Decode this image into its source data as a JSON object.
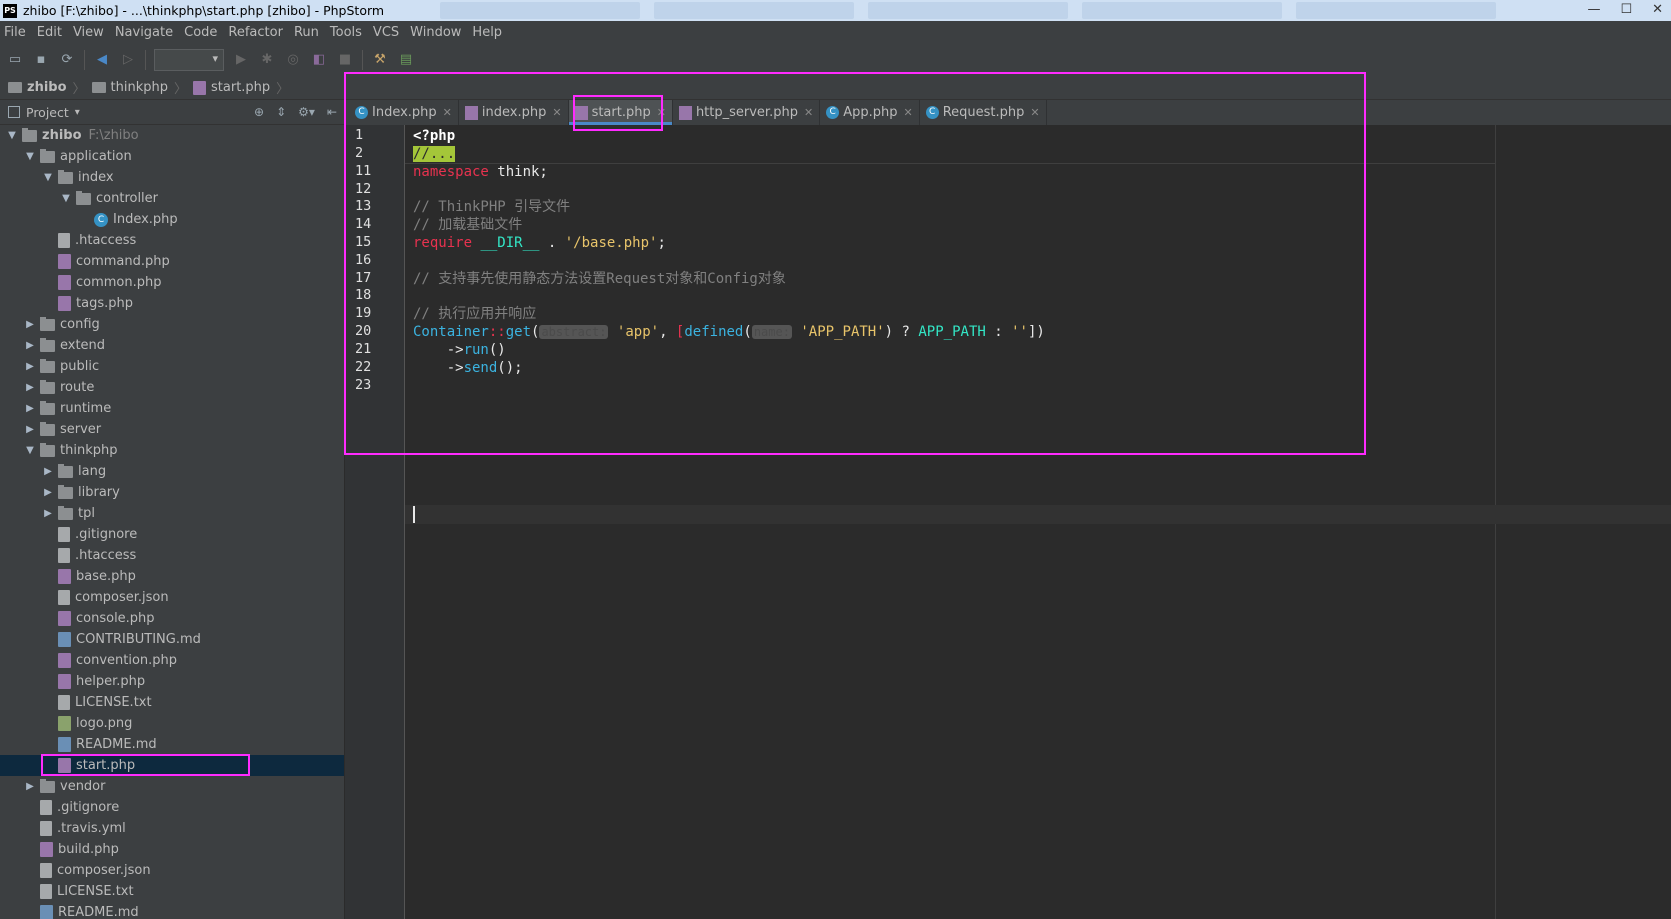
{
  "window": {
    "title": "zhibo [F:\\zhibo] - ...\\thinkphp\\start.php [zhibo] - PhpStorm",
    "logo": "PS",
    "controls": [
      "—",
      "☐",
      "✕"
    ]
  },
  "menu": [
    "File",
    "Edit",
    "View",
    "Navigate",
    "Code",
    "Refactor",
    "Run",
    "Tools",
    "VCS",
    "Window",
    "Help"
  ],
  "breadcrumb": [
    "zhibo",
    "thinkphp",
    "start.php"
  ],
  "project_panel": {
    "label": "Project"
  },
  "tree": [
    {
      "label": "zhibo",
      "extra": "F:\\zhibo",
      "depth": 0,
      "arrow": "▼",
      "icon": "folder",
      "bold": true
    },
    {
      "label": "application",
      "depth": 1,
      "arrow": "▼",
      "icon": "folder"
    },
    {
      "label": "index",
      "depth": 2,
      "arrow": "▼",
      "icon": "folder"
    },
    {
      "label": "controller",
      "depth": 3,
      "arrow": "▼",
      "icon": "folder"
    },
    {
      "label": "Index.php",
      "depth": 4,
      "arrow": "",
      "icon": "cls"
    },
    {
      "label": ".htaccess",
      "depth": 2,
      "arrow": "",
      "icon": "txt"
    },
    {
      "label": "command.php",
      "depth": 2,
      "arrow": "",
      "icon": "php"
    },
    {
      "label": "common.php",
      "depth": 2,
      "arrow": "",
      "icon": "php"
    },
    {
      "label": "tags.php",
      "depth": 2,
      "arrow": "",
      "icon": "php"
    },
    {
      "label": "config",
      "depth": 1,
      "arrow": "▶",
      "icon": "folder"
    },
    {
      "label": "extend",
      "depth": 1,
      "arrow": "▶",
      "icon": "folder"
    },
    {
      "label": "public",
      "depth": 1,
      "arrow": "▶",
      "icon": "folder"
    },
    {
      "label": "route",
      "depth": 1,
      "arrow": "▶",
      "icon": "folder"
    },
    {
      "label": "runtime",
      "depth": 1,
      "arrow": "▶",
      "icon": "folder"
    },
    {
      "label": "server",
      "depth": 1,
      "arrow": "▶",
      "icon": "folder"
    },
    {
      "label": "thinkphp",
      "depth": 1,
      "arrow": "▼",
      "icon": "folder"
    },
    {
      "label": "lang",
      "depth": 2,
      "arrow": "▶",
      "icon": "folder"
    },
    {
      "label": "library",
      "depth": 2,
      "arrow": "▶",
      "icon": "folder"
    },
    {
      "label": "tpl",
      "depth": 2,
      "arrow": "▶",
      "icon": "folder"
    },
    {
      "label": ".gitignore",
      "depth": 2,
      "arrow": "",
      "icon": "txt"
    },
    {
      "label": ".htaccess",
      "depth": 2,
      "arrow": "",
      "icon": "txt"
    },
    {
      "label": "base.php",
      "depth": 2,
      "arrow": "",
      "icon": "php"
    },
    {
      "label": "composer.json",
      "depth": 2,
      "arrow": "",
      "icon": "txt"
    },
    {
      "label": "console.php",
      "depth": 2,
      "arrow": "",
      "icon": "php"
    },
    {
      "label": "CONTRIBUTING.md",
      "depth": 2,
      "arrow": "",
      "icon": "md"
    },
    {
      "label": "convention.php",
      "depth": 2,
      "arrow": "",
      "icon": "php"
    },
    {
      "label": "helper.php",
      "depth": 2,
      "arrow": "",
      "icon": "php"
    },
    {
      "label": "LICENSE.txt",
      "depth": 2,
      "arrow": "",
      "icon": "txt"
    },
    {
      "label": "logo.png",
      "depth": 2,
      "arrow": "",
      "icon": "img"
    },
    {
      "label": "README.md",
      "depth": 2,
      "arrow": "",
      "icon": "md"
    },
    {
      "label": "start.php",
      "depth": 2,
      "arrow": "",
      "icon": "php",
      "selected": true
    },
    {
      "label": "vendor",
      "depth": 1,
      "arrow": "▶",
      "icon": "folder"
    },
    {
      "label": ".gitignore",
      "depth": 1,
      "arrow": "",
      "icon": "txt"
    },
    {
      "label": ".travis.yml",
      "depth": 1,
      "arrow": "",
      "icon": "txt"
    },
    {
      "label": "build.php",
      "depth": 1,
      "arrow": "",
      "icon": "php"
    },
    {
      "label": "composer.json",
      "depth": 1,
      "arrow": "",
      "icon": "txt"
    },
    {
      "label": "LICENSE.txt",
      "depth": 1,
      "arrow": "",
      "icon": "txt"
    },
    {
      "label": "README.md",
      "depth": 1,
      "arrow": "",
      "icon": "md"
    }
  ],
  "tabs": [
    {
      "label": "Index.php",
      "icon": "cls"
    },
    {
      "label": "index.php",
      "icon": "php"
    },
    {
      "label": "start.php",
      "icon": "php",
      "active": true
    },
    {
      "label": "http_server.php",
      "icon": "php"
    },
    {
      "label": "App.php",
      "icon": "cls"
    },
    {
      "label": "Request.php",
      "icon": "cls"
    }
  ],
  "line_numbers": [
    "1",
    "2",
    "11",
    "12",
    "13",
    "14",
    "15",
    "16",
    "17",
    "18",
    "19",
    "20",
    "21",
    "22",
    "23"
  ],
  "code": {
    "l1": "<?php",
    "l2": "//...",
    "l11_kw": "namespace",
    "l11_rest": " think;",
    "l13": "// ThinkPHP 引导文件",
    "l14": "// 加载基础文件",
    "l15_kw": "require",
    "l15_dir": " __DIR__ ",
    "l15_dot": ". ",
    "l15_str": "'/base.php'",
    "l15_end": ";",
    "l17": "// 支持事先使用静态方法设置Request对象和Config对象",
    "l19": "// 执行应用并响应",
    "l20_cls": "Container",
    "l20_op": "::",
    "l20_fn": "get",
    "l20_p1": "(",
    "l20_hint1": "abstract:",
    "l20_s1": " 'app'",
    "l20_p2": ", ",
    "l20_br": "[",
    "l20_fn2": "defined",
    "l20_p3": "(",
    "l20_hint2": "name:",
    "l20_s2": " 'APP_PATH'",
    "l20_p4": ") ? ",
    "l20_const": "APP_PATH",
    "l20_p5": " : ",
    "l20_s3": "''",
    "l20_end": "])",
    "l21_arrow": "    ->",
    "l21_fn": "run",
    "l21_end": "()",
    "l22_arrow": "    ->",
    "l22_fn": "send",
    "l22_end": "();"
  },
  "colors": {
    "highlight_box": "#ff2bff",
    "keyword": "#e8324f",
    "string": "#e8c46a",
    "comment": "#808080",
    "selection": "#0d293e"
  }
}
